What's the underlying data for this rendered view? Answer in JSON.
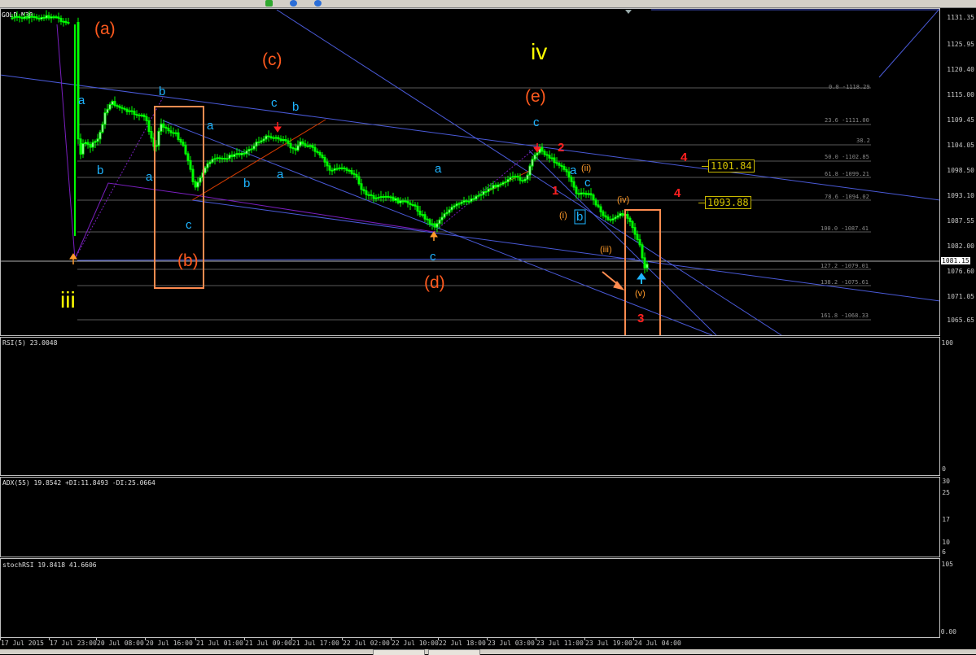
{
  "window": {
    "symbol_label": "GOLD,M30",
    "current_price": "1081.15"
  },
  "colors": {
    "background": "#000000",
    "bull_candle": "#00ff00",
    "bear_candle": "#00ff00",
    "rsi_line": "#ffff00",
    "adx_plus": "#00e000",
    "adx_minus": "#e00000",
    "wave_orange": "#ff5a1e",
    "wave_cyan": "#1eb4ff",
    "wave_red": "#ff2020",
    "wave_yellow": "#ffff00",
    "wave_sub": "#ff9a2a",
    "highlight_box": "#ff8c50",
    "trendline": "#4a5ad8"
  },
  "price_axis": {
    "ticks": [
      "1131.35",
      "1125.95",
      "1120.40",
      "1115.00",
      "1109.45",
      "1104.05",
      "1098.50",
      "1093.10",
      "1087.55",
      "1082.00",
      "1076.60",
      "1071.05",
      "1065.65"
    ]
  },
  "fib_levels": [
    {
      "label": "0.0 -1118.29"
    },
    {
      "label": "23.6 -1111.00"
    },
    {
      "label": "38.2"
    },
    {
      "label": "50.0 -1102.85"
    },
    {
      "label": "61.8 -1099.21"
    },
    {
      "label": "78.6 -1094.02"
    },
    {
      "label": "100.0 -1087.41"
    },
    {
      "label": "127.2 -1079.01"
    },
    {
      "label": "138.2 -1075.61"
    },
    {
      "label": "161.8 -1068.33"
    }
  ],
  "price_boxes": [
    "1101.84",
    "1093.88"
  ],
  "wave_labels": {
    "a_paren": "(a)",
    "c_paren": "(c)",
    "iv": "iv",
    "e_paren": "(e)",
    "iii": "iii",
    "b_paren": "(b)",
    "d_paren": "(d)",
    "small_a": "a",
    "small_b": "b",
    "small_c": "c",
    "n1": "1",
    "n2": "2",
    "n3": "3",
    "n4": "4",
    "sub_i": "(i)",
    "sub_ii": "(ii)",
    "sub_iii": "(iii)",
    "sub_iv": "(iv)",
    "sub_v": "(v)"
  },
  "rsi_pane": {
    "label": "RSI(5) 23.0048",
    "ticks": [
      "100",
      "0"
    ]
  },
  "adx_pane": {
    "label": "ADX(55) 19.8542 +DI:11.8493 -DI:25.0664",
    "ticks": [
      "30",
      "25",
      "17",
      "10",
      "6"
    ]
  },
  "stoch_pane": {
    "label": "stochRSI 19.8418 41.6606",
    "ticks": [
      "105",
      "0.00"
    ]
  },
  "time_axis": {
    "labels": [
      "17 Jul 2015",
      "17 Jul 23:00",
      "20 Jul 08:00",
      "20 Jul 16:00",
      "21 Jul 01:00",
      "21 Jul 09:00",
      "21 Jul 17:00",
      "22 Jul 02:00",
      "22 Jul 10:00",
      "22 Jul 18:00",
      "23 Jul 03:00",
      "23 Jul 11:00",
      "23 Jul 19:00",
      "24 Jul 04:00"
    ]
  }
}
